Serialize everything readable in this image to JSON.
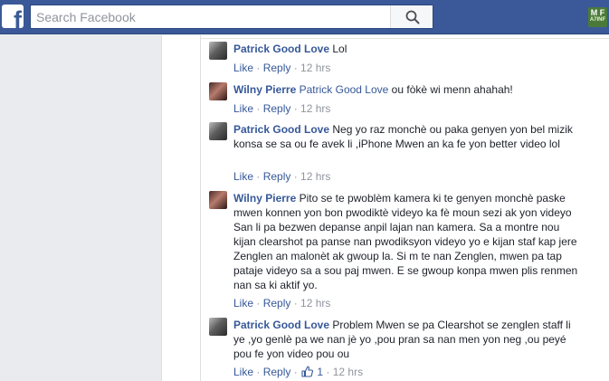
{
  "topbar": {
    "logo_letter": "f",
    "search_placeholder": "Search Facebook",
    "badge_line1": "M F",
    "badge_line2": "A7INF"
  },
  "comments": [
    {
      "author": "Patrick Good Love",
      "text": "Lol",
      "like_label": "Like",
      "reply_label": "Reply",
      "time": "12 hrs"
    },
    {
      "author": "Wilny Pierre",
      "tag": "Patrick Good Love",
      "text": "ou fòkè wi menn ahahah!",
      "like_label": "Like",
      "reply_label": "Reply",
      "time": "12 hrs"
    },
    {
      "author": "Patrick Good Love",
      "text": "Neg yo raz monchè ou paka genyen yon bel mizik konsa se sa ou fe avek li ,iPhone Mwen an ka fe yon better video lol",
      "like_label": "Like",
      "reply_label": "Reply",
      "time": "12 hrs"
    },
    {
      "author": "Wilny Pierre",
      "text": "Pito se te pwoblèm kamera ki te genyen monchè paske mwen konnen yon bon pwodiktè videyo ka fè moun sezi ak yon videyo San li pa bezwen depanse anpil lajan nan kamera. Sa a montre nou kijan clearshot pa panse nan pwodiksyon videyo yo e kijan staf kap jere Zenglen an malonèt ak gwoup la. Si m te nan Zenglen, mwen pa tap pataje videyo sa a sou paj mwen. E se gwoup konpa mwen plis renmen nan sa ki aktif yo.",
      "like_label": "Like",
      "reply_label": "Reply",
      "time": "12 hrs"
    },
    {
      "author": "Patrick Good Love",
      "text": "Problem Mwen se pa Clearshot se zenglen staff li ye ,yo genlè pa we nan jè yo ,pou pran sa nan men yon neg ,ou peyé pou fe yon video pou ou",
      "like_label": "Like",
      "reply_label": "Reply",
      "like_count": "1",
      "time": "12 hrs"
    }
  ]
}
